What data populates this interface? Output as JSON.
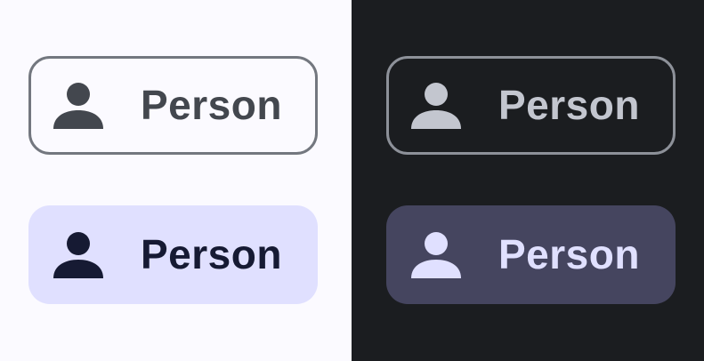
{
  "colors": {
    "light_background": "#fbfaff",
    "dark_background": "#1b1d20",
    "light_outlined_border": "#73777f",
    "light_outlined_content": "#43474e",
    "light_filled_container": "#e0e0ff",
    "light_filled_content": "#161a33",
    "dark_outlined_border": "#8d9199",
    "dark_outlined_content": "#c3c6cf",
    "dark_filled_container": "#45455f",
    "dark_filled_content": "#e0e0ff"
  },
  "chips": {
    "light_outlined": {
      "label": "Person",
      "icon": "person-icon"
    },
    "light_filled": {
      "label": "Person",
      "icon": "person-icon"
    },
    "dark_outlined": {
      "label": "Person",
      "icon": "person-icon"
    },
    "dark_filled": {
      "label": "Person",
      "icon": "person-icon"
    }
  }
}
